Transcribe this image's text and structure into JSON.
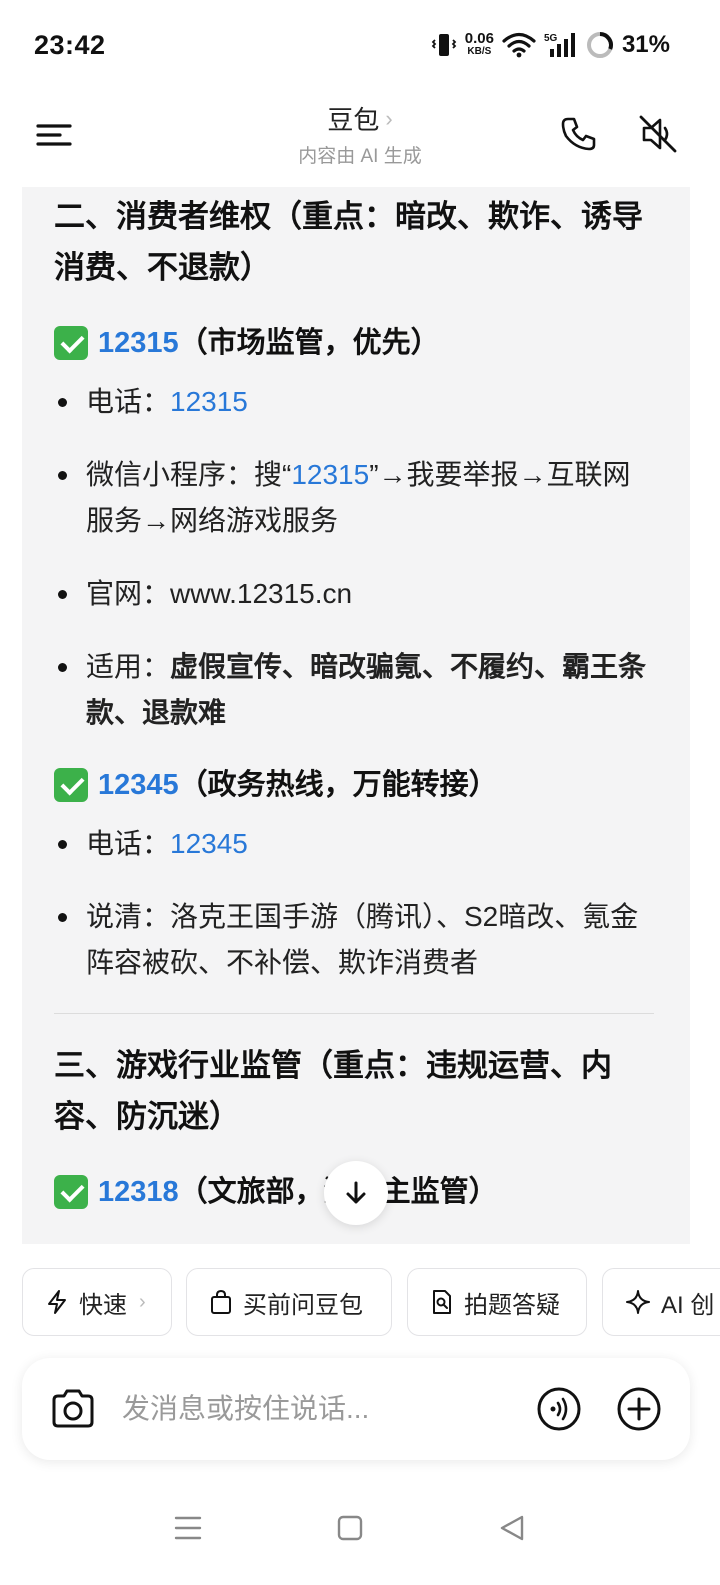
{
  "status_bar": {
    "time": "23:42",
    "net_speed": "0.06",
    "net_unit": "KB/S",
    "battery": "31%"
  },
  "header": {
    "title": "豆包",
    "subtitle": "内容由 AI 生成"
  },
  "content": {
    "section2_title": "二、消费者维权（重点：暗改、欺诈、诱导消费、不退款）",
    "hotline_12315": {
      "number": "12315",
      "note": "（市场监管，优先）",
      "items": [
        {
          "label": "电话：",
          "value": "12315"
        },
        {
          "pre": "微信小程序：搜“",
          "value": "12315",
          "post": "”→我要举报→互联网服务→网络游戏服务"
        },
        {
          "text": "官网：www.12315.cn"
        },
        {
          "label": "适用：",
          "bold": "虚假宣传、暗改骗氪、不履约、霸王条款、退款难"
        }
      ]
    },
    "hotline_12345": {
      "number": "12345",
      "note": "（政务热线，万能转接）",
      "items": [
        {
          "label": "电话：",
          "value": "12345"
        },
        {
          "text": "说清：洛克王国手游（腾讯）、S2暗改、氪金阵容被砍、不补偿、欺诈消费者"
        }
      ]
    },
    "section3_title": "三、游戏行业监管（重点：违规运营、内容、防沉迷）",
    "hotline_12318": {
      "number": "12318",
      "note": "（文旅部，游戏主监管）"
    }
  },
  "chips": [
    {
      "label": "快速",
      "icon": "bolt-icon"
    },
    {
      "label": "买前问豆包",
      "icon": "shopping-bag-icon"
    },
    {
      "label": "拍题答疑",
      "icon": "doc-search-icon"
    },
    {
      "label": "AI 创",
      "icon": "sparkle-icon"
    }
  ],
  "input": {
    "placeholder": "发消息或按住说话..."
  }
}
